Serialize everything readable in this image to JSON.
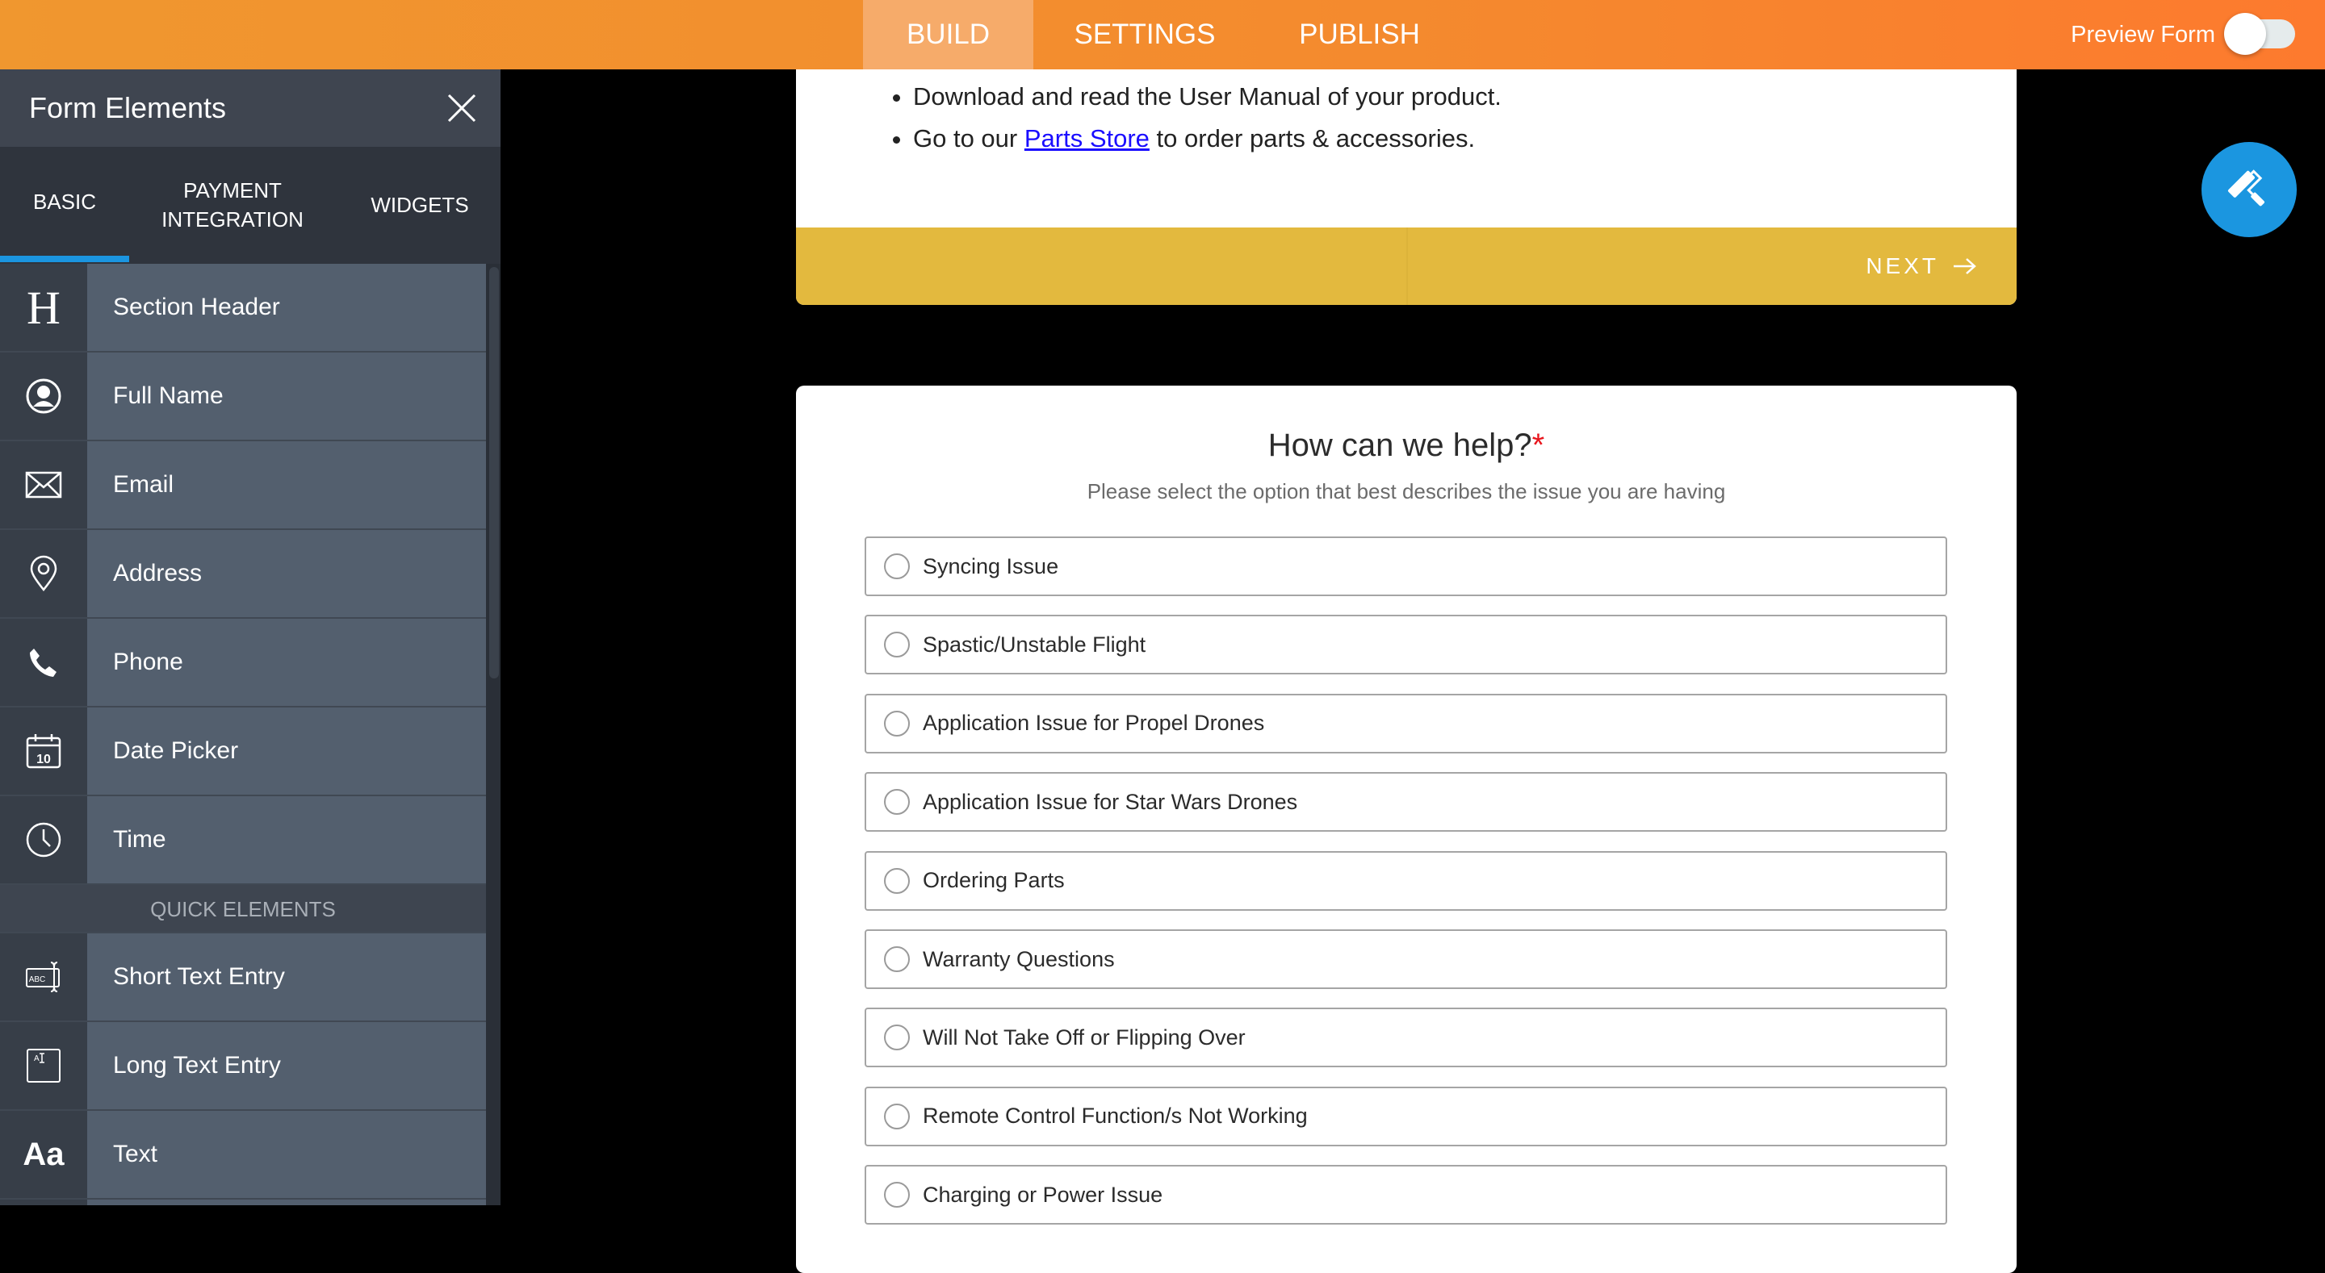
{
  "topbar": {
    "tabs": [
      {
        "label": "BUILD",
        "active": true
      },
      {
        "label": "SETTINGS"
      },
      {
        "label": "PUBLISH"
      }
    ],
    "preview_label": "Preview Form",
    "preview_on": false,
    "colors": {
      "bar_start": "#f0972f",
      "bar_end": "#fd7a2e"
    }
  },
  "sidebar": {
    "title": "Form Elements",
    "tabs": [
      {
        "label": "BASIC",
        "active": true
      },
      {
        "label": "PAYMENT INTEGRATION"
      },
      {
        "label": "WIDGETS"
      }
    ],
    "items": [
      {
        "label": "Section Header",
        "icon": "heading-icon"
      },
      {
        "label": "Full Name",
        "icon": "user-icon"
      },
      {
        "label": "Email",
        "icon": "envelope-icon"
      },
      {
        "label": "Address",
        "icon": "map-pin-icon"
      },
      {
        "label": "Phone",
        "icon": "phone-icon"
      },
      {
        "label": "Date Picker",
        "icon": "calendar-icon"
      },
      {
        "label": "Time",
        "icon": "clock-icon"
      }
    ],
    "quick_header": "QUICK ELEMENTS",
    "quick_items": [
      {
        "label": "Short Text Entry",
        "icon": "short-text-icon"
      },
      {
        "label": "Long Text Entry",
        "icon": "long-text-icon"
      },
      {
        "label": "Text",
        "icon": "text-icon"
      }
    ],
    "calendar_day": "10"
  },
  "card1": {
    "bullet1": "Download and read the User Manual of your product.",
    "bullet2_pre": "Go to our ",
    "bullet2_link": "Parts Store",
    "bullet2_post": " to order parts & accessories.",
    "next_label": "NEXT",
    "accent": "#e3b93e"
  },
  "question": {
    "title": "How can we help?",
    "required_mark": "*",
    "subtitle": "Please select the option that best describes the issue you are having",
    "options": [
      "Syncing Issue",
      "Spastic/Unstable Flight",
      "Application Issue for Propel Drones",
      "Application Issue for Star Wars Drones",
      "Ordering Parts",
      "Warranty Questions",
      "Will Not Take Off or Flipping Over",
      "Remote Control Function/s Not Working",
      "Charging or Power Issue"
    ]
  },
  "fab": {
    "icon": "paint-roller-icon",
    "color": "#1b96e0"
  }
}
